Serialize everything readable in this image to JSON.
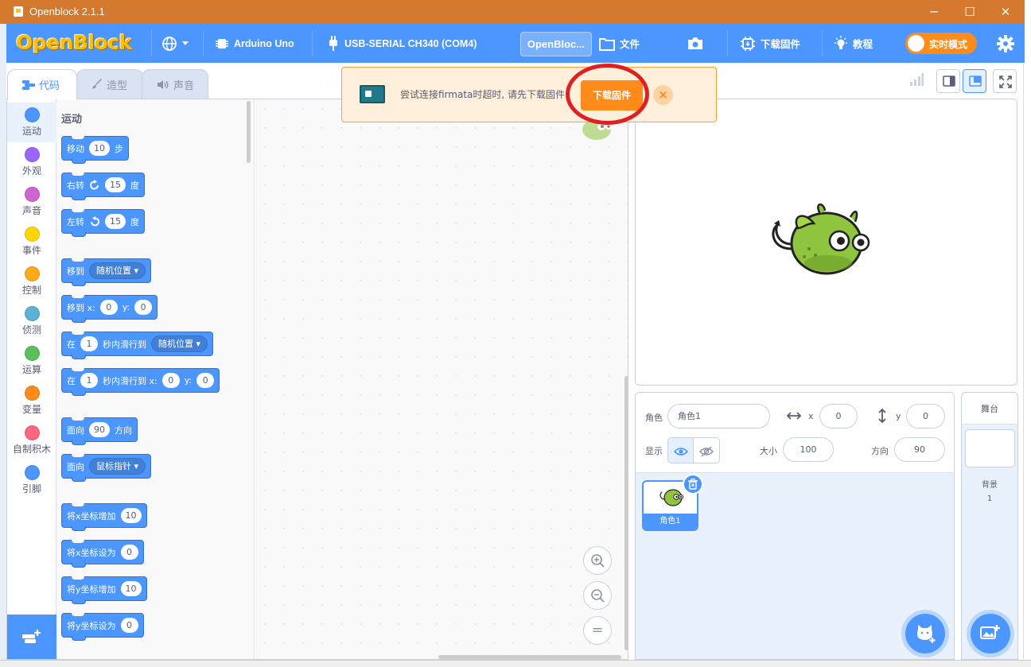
{
  "window": {
    "title": "Openblock 2.1.1",
    "minimize": "─",
    "maximize": "☐",
    "close": "✕"
  },
  "menu": {
    "logo": "OpenBlock",
    "board": "Arduino Uno",
    "port": "USB-SERIAL CH340 (COM4)",
    "project_name": "OpenBloc...",
    "file": "文件",
    "upload_firmware": "下载固件",
    "tutorial": "教程",
    "realtime_mode": "实时模式"
  },
  "tabs": {
    "code": "代码",
    "costumes": "造型",
    "sounds": "声音"
  },
  "categories": [
    {
      "label": "运动",
      "color": "#4c97ff"
    },
    {
      "label": "外观",
      "color": "#9966ff"
    },
    {
      "label": "声音",
      "color": "#cf63cf"
    },
    {
      "label": "事件",
      "color": "#ffd500"
    },
    {
      "label": "控制",
      "color": "#ffab19"
    },
    {
      "label": "侦测",
      "color": "#5cb1d6"
    },
    {
      "label": "运算",
      "color": "#59c059"
    },
    {
      "label": "变量",
      "color": "#ff8c1a"
    },
    {
      "label": "自制积木",
      "color": "#ff6680"
    },
    {
      "label": "引脚",
      "color": "#4c97ff"
    }
  ],
  "flyout": {
    "heading": "运动",
    "move": {
      "a": "移动",
      "v": "10",
      "b": "步"
    },
    "turn_right": {
      "a": "右转",
      "v": "15",
      "b": "度"
    },
    "turn_left": {
      "a": "左转",
      "v": "15",
      "b": "度"
    },
    "goto": {
      "a": "移到",
      "d": "随机位置"
    },
    "goto_xy": {
      "a": "移到 x:",
      "x": "0",
      "ylbl": "y:",
      "y": "0"
    },
    "glide": {
      "a": "在",
      "v": "1",
      "b": "秒内滑行到",
      "d": "随机位置"
    },
    "glide_xy": {
      "a": "在",
      "v": "1",
      "b": "秒内滑行到 x:",
      "x": "0",
      "ylbl": "y:",
      "y": "0"
    },
    "point_dir": {
      "a": "面向",
      "v": "90",
      "b": "方向"
    },
    "point_towards": {
      "a": "面向",
      "d": "鼠标指针"
    },
    "change_x": {
      "a": "将x坐标增加",
      "v": "10"
    },
    "set_x": {
      "a": "将x坐标设为",
      "v": "0"
    },
    "change_y": {
      "a": "将y坐标增加",
      "v": "10"
    },
    "set_y": {
      "a": "将y坐标设为",
      "v": "0"
    }
  },
  "alert": {
    "message": "尝试连接firmata时超时, 请先下载固件",
    "button": "下载固件",
    "close": "×"
  },
  "sprite_info": {
    "sprite_label": "角色",
    "sprite_name": "角色1",
    "x_label": "x",
    "x_value": "0",
    "y_label": "y",
    "y_value": "0",
    "show_label": "显示",
    "size_label": "大小",
    "size_value": "100",
    "direction_label": "方向",
    "direction_value": "90"
  },
  "sprites": [
    {
      "name": "角色1"
    }
  ],
  "stage_panel": {
    "title": "舞台",
    "backdrops_label": "背景",
    "backdrops_count": "1"
  },
  "zoom": {
    "in": "+",
    "out": "−",
    "reset": "="
  },
  "colors": {
    "accent": "#4c97ff",
    "title_bar": "#d5792e",
    "orange": "#ff8c1a",
    "highlight_circle": "#e02020"
  }
}
